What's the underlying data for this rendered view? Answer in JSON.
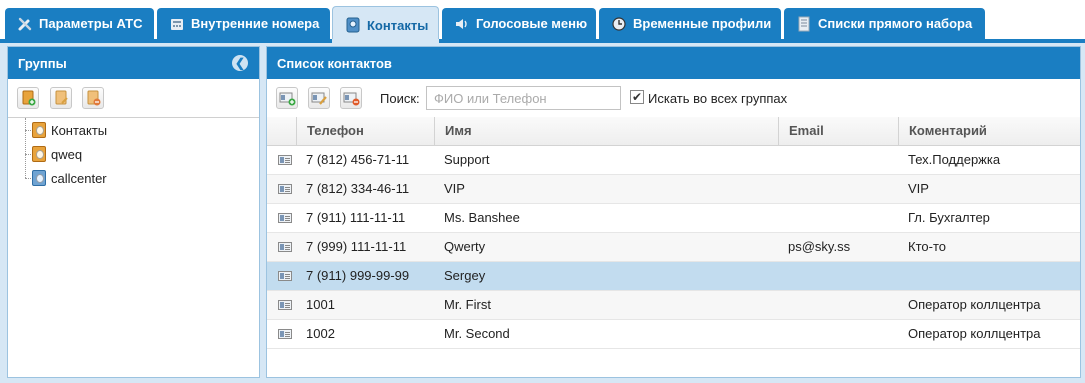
{
  "tabs": [
    {
      "label": "Параметры АТС",
      "icon": "wrench-icon"
    },
    {
      "label": "Внутренние номера",
      "icon": "phone-icon"
    },
    {
      "label": "Контакты",
      "icon": "contacts-icon",
      "active": true
    },
    {
      "label": "Голосовые меню",
      "icon": "speaker-icon"
    },
    {
      "label": "Временные профили",
      "icon": "clock-icon"
    },
    {
      "label": "Списки прямого набора",
      "icon": "list-icon"
    }
  ],
  "groups_panel": {
    "title": "Группы",
    "collapse_icon": "collapse-left-icon",
    "toolbar": [
      "add-group-icon",
      "edit-group-icon",
      "delete-group-icon"
    ],
    "tree": [
      {
        "label": "Контакты",
        "icon": "address-book-icon"
      },
      {
        "label": "qweq",
        "icon": "address-book-icon"
      },
      {
        "label": "callcenter",
        "icon": "address-book-blue-icon"
      }
    ]
  },
  "contacts_panel": {
    "title": "Список контактов",
    "toolbar": [
      "add-contact-icon",
      "edit-contact-icon",
      "delete-contact-icon"
    ],
    "search": {
      "label": "Поиск:",
      "placeholder": "ФИО или Телефон",
      "value": ""
    },
    "search_all_groups": {
      "label": "Искать во всех группах",
      "checked": true
    },
    "columns": [
      "Телефон",
      "Имя",
      "Email",
      "Коментарий"
    ],
    "rows": [
      {
        "phone": "7 (812) 456-71-11",
        "name": "Support",
        "email": "",
        "comment": "Тех.Поддержка"
      },
      {
        "phone": "7 (812) 334-46-11",
        "name": "VIP",
        "email": "",
        "comment": "VIP"
      },
      {
        "phone": "7 (911) 111-11-11",
        "name": "Ms. Banshee",
        "email": "",
        "comment": "Гл. Бухгалтер"
      },
      {
        "phone": "7 (999) 111-11-11",
        "name": "Qwerty",
        "email": "ps@sky.ss",
        "comment": "Кто-то"
      },
      {
        "phone": "7 (911) 999-99-99",
        "name": "Sergey",
        "email": "",
        "comment": "",
        "selected": true
      },
      {
        "phone": "1001",
        "name": "Mr. First",
        "email": "",
        "comment": "Оператор коллцентра"
      },
      {
        "phone": "1002",
        "name": "Mr. Second",
        "email": "",
        "comment": "Оператор коллцентра"
      }
    ]
  },
  "colors": {
    "accent": "#1a7ec2",
    "selected_row": "#c2dcef",
    "frame": "#d6e7f5"
  }
}
